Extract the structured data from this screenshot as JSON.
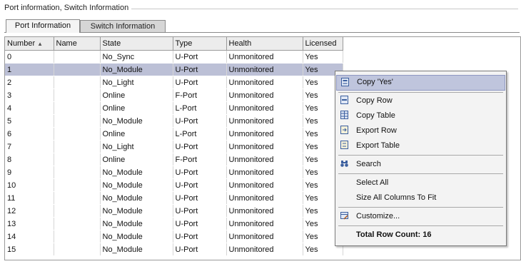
{
  "group": {
    "title": "Port information, Switch Information"
  },
  "tabs": [
    {
      "label": "Port Information",
      "active": true
    },
    {
      "label": "Switch Information",
      "active": false
    }
  ],
  "table": {
    "columns": [
      "Number",
      "Name",
      "State",
      "Type",
      "Health",
      "Licensed"
    ],
    "sort_icon": "sort-ascending-icon",
    "selected_row": 1,
    "rows": [
      [
        "0",
        "",
        "No_Sync",
        "U-Port",
        "Unmonitored",
        "Yes"
      ],
      [
        "1",
        "",
        "No_Module",
        "U-Port",
        "Unmonitored",
        "Yes"
      ],
      [
        "2",
        "",
        "No_Light",
        "U-Port",
        "Unmonitored",
        "Yes"
      ],
      [
        "3",
        "",
        "Online",
        "F-Port",
        "Unmonitored",
        "Yes"
      ],
      [
        "4",
        "",
        "Online",
        "L-Port",
        "Unmonitored",
        "Yes"
      ],
      [
        "5",
        "",
        "No_Module",
        "U-Port",
        "Unmonitored",
        "Yes"
      ],
      [
        "6",
        "",
        "Online",
        "L-Port",
        "Unmonitored",
        "Yes"
      ],
      [
        "7",
        "",
        "No_Light",
        "U-Port",
        "Unmonitored",
        "Yes"
      ],
      [
        "8",
        "",
        "Online",
        "F-Port",
        "Unmonitored",
        "Yes"
      ],
      [
        "9",
        "",
        "No_Module",
        "U-Port",
        "Unmonitored",
        "Yes"
      ],
      [
        "10",
        "",
        "No_Module",
        "U-Port",
        "Unmonitored",
        "Yes"
      ],
      [
        "11",
        "",
        "No_Module",
        "U-Port",
        "Unmonitored",
        "Yes"
      ],
      [
        "12",
        "",
        "No_Module",
        "U-Port",
        "Unmonitored",
        "Yes"
      ],
      [
        "13",
        "",
        "No_Module",
        "U-Port",
        "Unmonitored",
        "Yes"
      ],
      [
        "14",
        "",
        "No_Module",
        "U-Port",
        "Unmonitored",
        "Yes"
      ],
      [
        "15",
        "",
        "No_Module",
        "U-Port",
        "Unmonitored",
        "Yes"
      ]
    ]
  },
  "context_menu": {
    "items": [
      {
        "label": "Copy 'Yes'",
        "icon": "copy-cell-icon",
        "highlighted": true
      },
      {
        "label": "Copy Row",
        "icon": "copy-row-icon"
      },
      {
        "label": "Copy Table",
        "icon": "copy-table-icon"
      },
      {
        "label": "Export Row",
        "icon": "export-row-icon"
      },
      {
        "label": "Export Table",
        "icon": "export-table-icon"
      },
      {
        "label": "Search",
        "icon": "binoculars-icon"
      },
      {
        "label": "Select All"
      },
      {
        "label": "Size All Columns To Fit"
      },
      {
        "label": "Customize...",
        "icon": "customize-icon"
      },
      {
        "label": "Total Row Count: 16"
      }
    ]
  },
  "colors": {
    "selection": "#bcc0d6",
    "menu_highlight": "#bfc5dd",
    "icon_blue": "#3b5f9e"
  }
}
